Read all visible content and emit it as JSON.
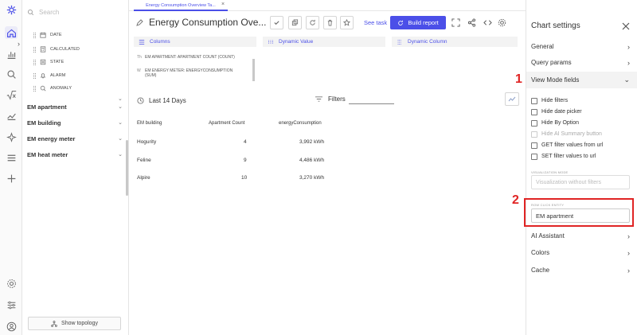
{
  "left_panel": {
    "search_placeholder": "Search",
    "fields": [
      {
        "label": "DATE",
        "icon": "calendar-icon"
      },
      {
        "label": "CALCULATED",
        "icon": "calculator-icon"
      },
      {
        "label": "STATE",
        "icon": "state-icon"
      },
      {
        "label": "ALARM",
        "icon": "bell-icon"
      },
      {
        "label": "ANOMALY",
        "icon": "magnifier-icon"
      }
    ],
    "groups": [
      "EM apartment",
      "EM building",
      "EM energy meter",
      "EM heat meter"
    ],
    "show_topology": "Show topology"
  },
  "tabs": [
    {
      "label": "Energy Consumption Overview Ta..."
    }
  ],
  "header": {
    "title": "Energy Consumption Ove...",
    "see_task": "See task",
    "build_report": "Build report"
  },
  "panels": {
    "columns": "Columns",
    "dynamic_value": "Dynamic Value",
    "dynamic_column": "Dynamic Column",
    "column_items": [
      {
        "prefix": "Th",
        "text": "EM APARTMENT: APARTMENT COUNT (COUNT)"
      },
      {
        "prefix": "W",
        "text": "EM ENERGY METER: ENERGYCONSUMPTION (SUM)"
      }
    ]
  },
  "report": {
    "date_range": "Last 14 Days",
    "filters": "Filters",
    "table": {
      "headers": [
        "EM building",
        "Apartment Count",
        "energyConsumption"
      ],
      "rows": [
        [
          "Hogurity",
          "4",
          "3,992 kWh"
        ],
        [
          "Feline",
          "9",
          "4,486 kWh"
        ],
        [
          "Alpire",
          "10",
          "3,270 kWh"
        ]
      ]
    }
  },
  "settings": {
    "title": "Chart settings",
    "sections": [
      "General",
      "Query params",
      "View Mode fields"
    ],
    "view_mode_options": [
      {
        "label": "Hide filters",
        "disabled": false
      },
      {
        "label": "Hide date picker",
        "disabled": false
      },
      {
        "label": "Hide By Option",
        "disabled": false
      },
      {
        "label": "Hide AI Summary button",
        "disabled": true
      },
      {
        "label": "GET filter values from url",
        "disabled": false
      },
      {
        "label": "SET filter values to url",
        "disabled": false
      }
    ],
    "viz_label": "VISUALIZATION MODE",
    "viz_placeholder": "Visualization without filters",
    "row_click_label": "ROW CLICK ENTITY",
    "row_click_value": "EM apartment",
    "bottom_sections": [
      "AI Assistant",
      "Colors",
      "Cache"
    ]
  },
  "annotations": {
    "one": "1",
    "two": "2"
  },
  "colors": {
    "accent": "#4b4fe8",
    "annotation": "#e02424"
  }
}
